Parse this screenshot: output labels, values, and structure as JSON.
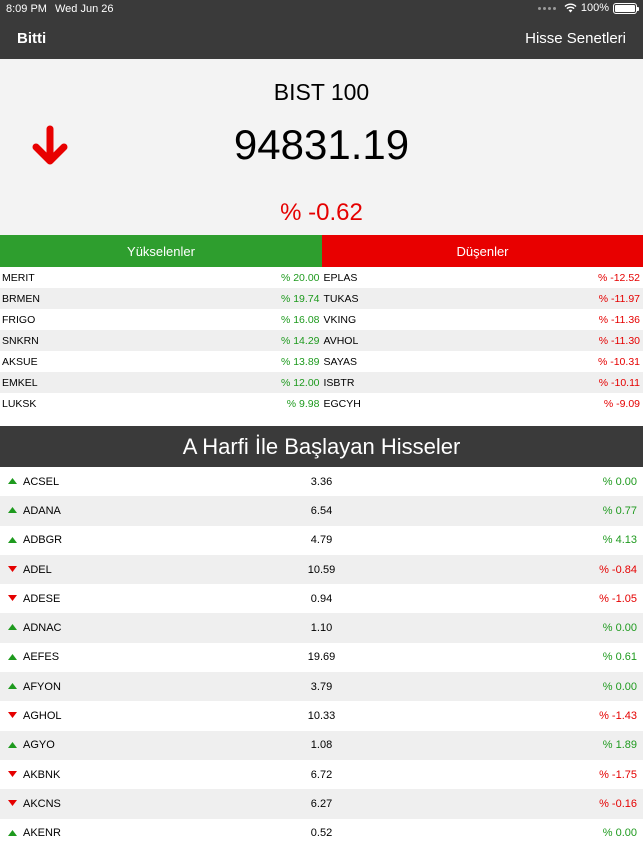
{
  "status_bar": {
    "time": "8:09 PM",
    "date": "Wed Jun 26",
    "battery": "100%"
  },
  "nav": {
    "done_label": "Bitti",
    "title": "Hisse Senetleri"
  },
  "index": {
    "name": "BIST 100",
    "value": "94831.19",
    "change": "% -0.62",
    "direction": "down"
  },
  "movers": {
    "gainers_label": "Yükselenler",
    "losers_label": "Düşenler",
    "rows": [
      {
        "gainer": "MERIT",
        "gainer_change": "% 20.00",
        "loser": "EPLAS",
        "loser_change": "% -12.52"
      },
      {
        "gainer": "BRMEN",
        "gainer_change": "% 19.74",
        "loser": "TUKAS",
        "loser_change": "% -11.97"
      },
      {
        "gainer": "FRIGO",
        "gainer_change": "% 16.08",
        "loser": "VKING",
        "loser_change": "% -11.36"
      },
      {
        "gainer": "SNKRN",
        "gainer_change": "% 14.29",
        "loser": "AVHOL",
        "loser_change": "% -11.30"
      },
      {
        "gainer": "AKSUE",
        "gainer_change": "% 13.89",
        "loser": "SAYAS",
        "loser_change": "% -10.31"
      },
      {
        "gainer": "EMKEL",
        "gainer_change": "% 12.00",
        "loser": "ISBTR",
        "loser_change": "% -10.11"
      },
      {
        "gainer": "LUKSK",
        "gainer_change": "% 9.98",
        "loser": "EGCYH",
        "loser_change": "% -9.09"
      }
    ]
  },
  "section_title": "A Harfi İle Başlayan Hisseler",
  "colors": {
    "up": "#1e9a1e",
    "down": "#e50000",
    "header": "#3a3a3a"
  },
  "stocks": [
    {
      "symbol": "ACSEL",
      "price": "3.36",
      "change": "% 0.00",
      "direction": "up"
    },
    {
      "symbol": "ADANA",
      "price": "6.54",
      "change": "% 0.77",
      "direction": "up"
    },
    {
      "symbol": "ADBGR",
      "price": "4.79",
      "change": "% 4.13",
      "direction": "up"
    },
    {
      "symbol": "ADEL",
      "price": "10.59",
      "change": "% -0.84",
      "direction": "down"
    },
    {
      "symbol": "ADESE",
      "price": "0.94",
      "change": "% -1.05",
      "direction": "down"
    },
    {
      "symbol": "ADNAC",
      "price": "1.10",
      "change": "% 0.00",
      "direction": "up"
    },
    {
      "symbol": "AEFES",
      "price": "19.69",
      "change": "% 0.61",
      "direction": "up"
    },
    {
      "symbol": "AFYON",
      "price": "3.79",
      "change": "% 0.00",
      "direction": "up"
    },
    {
      "symbol": "AGHOL",
      "price": "10.33",
      "change": "% -1.43",
      "direction": "down"
    },
    {
      "symbol": "AGYO",
      "price": "1.08",
      "change": "% 1.89",
      "direction": "up"
    },
    {
      "symbol": "AKBNK",
      "price": "6.72",
      "change": "% -1.75",
      "direction": "down"
    },
    {
      "symbol": "AKCNS",
      "price": "6.27",
      "change": "% -0.16",
      "direction": "down"
    },
    {
      "symbol": "AKENR",
      "price": "0.52",
      "change": "% 0.00",
      "direction": "up"
    }
  ]
}
